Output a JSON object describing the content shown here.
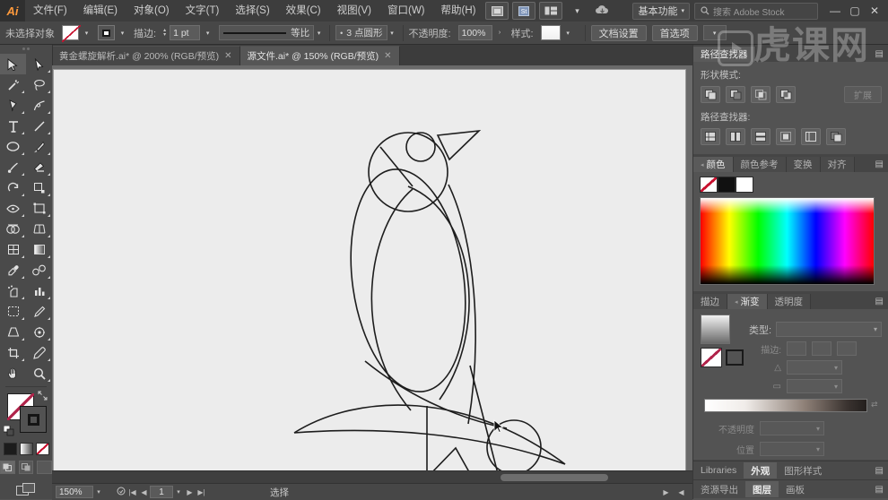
{
  "app": {
    "logo": "Ai",
    "watermark": "虎课网"
  },
  "menubar": {
    "items": [
      {
        "label": "文件(F)"
      },
      {
        "label": "编辑(E)"
      },
      {
        "label": "对象(O)"
      },
      {
        "label": "文字(T)"
      },
      {
        "label": "选择(S)"
      },
      {
        "label": "效果(C)"
      },
      {
        "label": "视图(V)"
      },
      {
        "label": "窗口(W)"
      },
      {
        "label": "帮助(H)"
      }
    ],
    "workspace": "基本功能",
    "search_placeholder": "搜索 Adobe Stock",
    "minimize": "—",
    "maximize": "▢",
    "close": "✕"
  },
  "controlbar": {
    "selection_status": "未选择对象",
    "stroke_label": "描边:",
    "stroke_width": "1 pt",
    "stroke_profile": "等比",
    "corner_label": "3 点圆形",
    "opacity_label": "不透明度:",
    "opacity_value": "100%",
    "style_label": "样式:",
    "doc_setup": "文档设置",
    "preferences": "首选项"
  },
  "tabs": [
    {
      "label": "黄金螺旋解析.ai* @ 200% (RGB/预览)",
      "active": false,
      "close": "✕"
    },
    {
      "label": "源文件.ai* @ 150% (RGB/预览)",
      "active": true,
      "close": "✕"
    }
  ],
  "toolbar": {
    "tools": [
      {
        "name": "selection-tool",
        "selected": true
      },
      {
        "name": "direct-selection-tool",
        "selected": false
      },
      {
        "name": "magic-wand-tool",
        "selected": false
      },
      {
        "name": "lasso-tool",
        "selected": false
      },
      {
        "name": "pen-tool",
        "selected": false
      },
      {
        "name": "curvature-tool",
        "selected": false
      },
      {
        "name": "type-tool",
        "selected": false
      },
      {
        "name": "line-segment-tool",
        "selected": false
      },
      {
        "name": "ellipse-tool",
        "selected": false
      },
      {
        "name": "paintbrush-tool",
        "selected": false
      },
      {
        "name": "shaper-tool",
        "selected": false
      },
      {
        "name": "eraser-tool",
        "selected": false
      },
      {
        "name": "rotate-tool",
        "selected": false
      },
      {
        "name": "scale-tool",
        "selected": false
      },
      {
        "name": "width-tool",
        "selected": false
      },
      {
        "name": "free-transform-tool",
        "selected": false
      },
      {
        "name": "shape-builder-tool",
        "selected": false
      },
      {
        "name": "perspective-grid-tool",
        "selected": false
      },
      {
        "name": "mesh-tool",
        "selected": false
      },
      {
        "name": "gradient-tool",
        "selected": false
      },
      {
        "name": "eyedropper-tool",
        "selected": false
      },
      {
        "name": "blend-tool",
        "selected": false
      },
      {
        "name": "symbol-sprayer-tool",
        "selected": false
      },
      {
        "name": "column-graph-tool",
        "selected": false
      },
      {
        "name": "artboard-tool",
        "selected": false
      },
      {
        "name": "slice-tool",
        "selected": false
      },
      {
        "name": "hand-tool",
        "selected": false
      },
      {
        "name": "zoom-tool",
        "selected": false
      }
    ]
  },
  "canvas": {
    "artwork_name": "bird-line-art",
    "background": "#ececec"
  },
  "statusbar": {
    "zoom": "150%",
    "page": "1",
    "tool": "选择",
    "prev_page": "◀",
    "next_page": "▶"
  },
  "panels": {
    "pathfinder": {
      "tabs": [
        {
          "label": "路径查找器",
          "active": true
        }
      ],
      "shape_modes_label": "形状模式:",
      "pathfinder_label": "路径查找器:",
      "expand_label": "扩展",
      "menu": "▤"
    },
    "color": {
      "tabs": [
        {
          "label": "颜色",
          "active": true
        },
        {
          "label": "颜色参考",
          "active": false
        },
        {
          "label": "变换",
          "active": false
        },
        {
          "label": "对齐",
          "active": false
        }
      ],
      "menu": "▤"
    },
    "gradient": {
      "tabs": [
        {
          "label": "描边",
          "active": false
        },
        {
          "label": "渐变",
          "active": true
        },
        {
          "label": "透明度",
          "active": false
        }
      ],
      "type_label": "类型:",
      "stroke_label": "描边:",
      "angle_label": "△",
      "aspect_label": "▭",
      "opacity_label": "不透明度",
      "location_label": "位置",
      "menu": "▤"
    },
    "bottom_row_1": {
      "tabs": [
        {
          "label": "Libraries",
          "active": false
        },
        {
          "label": "外观",
          "active": true
        },
        {
          "label": "图形样式",
          "active": false
        }
      ],
      "menu": "▤"
    },
    "bottom_row_2": {
      "tabs": [
        {
          "label": "资源导出",
          "active": false
        },
        {
          "label": "图层",
          "active": true
        },
        {
          "label": "画板",
          "active": false
        }
      ],
      "menu": "▤"
    }
  }
}
